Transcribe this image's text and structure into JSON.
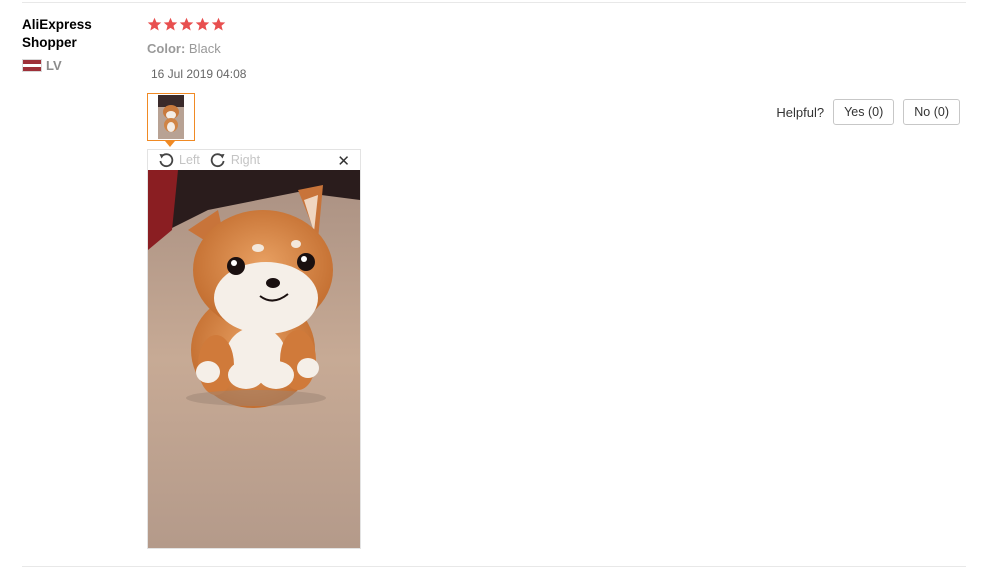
{
  "review": {
    "reviewer_name": "AliExpress Shopper",
    "country_code": "LV",
    "rating": 5,
    "color_label": "Color:",
    "color_value": "Black",
    "date": "16 Jul 2019 04:08",
    "star_color": "#e84f4f",
    "accent_color": "#f08a24"
  },
  "viewer": {
    "rotate_left_label": "Left",
    "rotate_right_label": "Right",
    "close_glyph": "✕"
  },
  "helpful": {
    "question": "Helpful?",
    "yes_label": "Yes (0)",
    "no_label": "No (0)"
  }
}
